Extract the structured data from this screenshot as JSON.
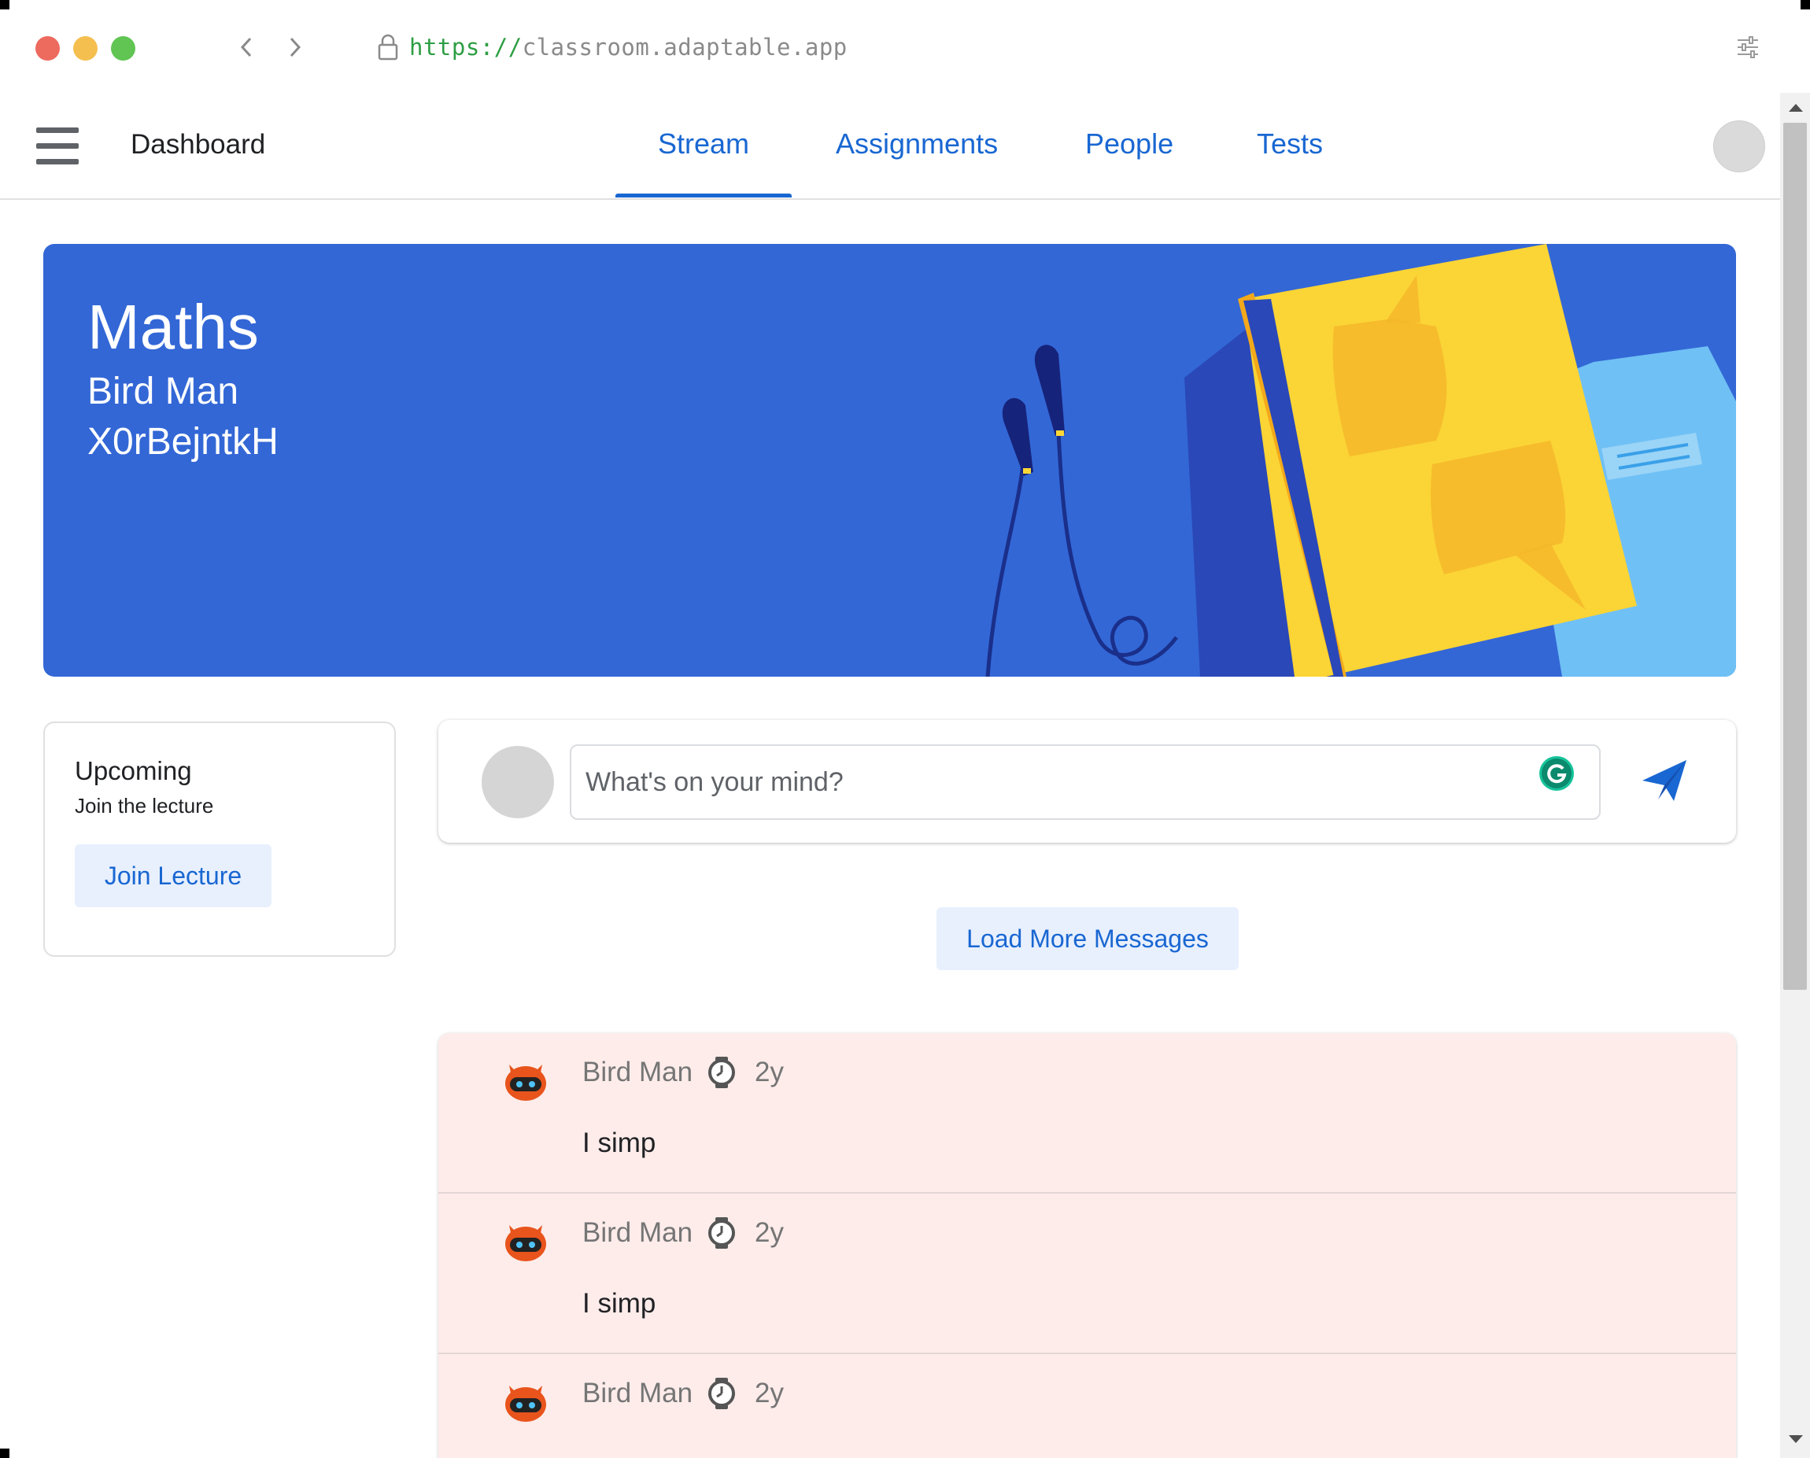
{
  "browser": {
    "url_scheme": "https://",
    "url_host": "classroom.adaptable.app"
  },
  "nav": {
    "title": "Dashboard",
    "tabs": [
      {
        "label": "Stream",
        "active": true
      },
      {
        "label": "Assignments",
        "active": false
      },
      {
        "label": "People",
        "active": false
      },
      {
        "label": "Tests",
        "active": false
      }
    ]
  },
  "banner": {
    "class_name": "Maths",
    "teacher": "Bird Man",
    "class_code": "X0rBejntkH"
  },
  "upcoming": {
    "title": "Upcoming",
    "subtitle": "Join the lecture",
    "button_label": "Join Lecture"
  },
  "composer": {
    "placeholder": "What's on your mind?"
  },
  "load_more_label": "Load More Messages",
  "messages": [
    {
      "author": "Bird Man",
      "time": "2y",
      "text": "I simp"
    },
    {
      "author": "Bird Man",
      "time": "2y",
      "text": "I simp"
    },
    {
      "author": "Bird Man",
      "time": "2y",
      "text": ""
    }
  ],
  "colors": {
    "primary": "#1967d2",
    "banner": "#3367d6",
    "message_bg": "#fdecea",
    "button_bg": "#e8f0fe"
  }
}
